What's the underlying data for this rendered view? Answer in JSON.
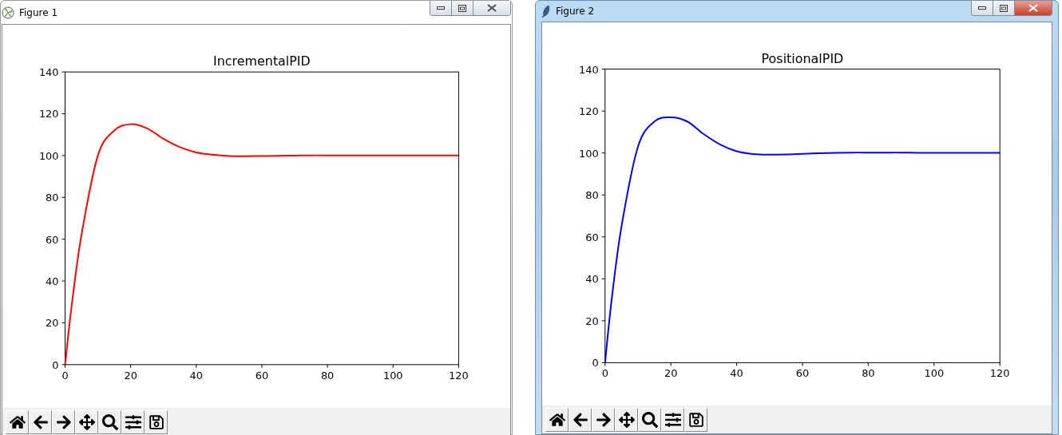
{
  "windows": [
    {
      "title": "Figure 1",
      "active": false,
      "chart_data": {
        "type": "line",
        "title": "IncrementalPID",
        "x": [
          0,
          2,
          5,
          10,
          15,
          20,
          25,
          30,
          35,
          40,
          45,
          50,
          55,
          60,
          65,
          70,
          75,
          80,
          85,
          90,
          95,
          100,
          105,
          110,
          115,
          120
        ],
        "series": [
          {
            "color": "#ff0000",
            "values": [
              0,
              28,
              62,
              100,
              112,
              115,
              113,
              108,
              104,
              101.5,
              100.4,
              99.8,
              99.7,
              99.8,
              99.9,
              100,
              100.1,
              100.1,
              100.1,
              100.1,
              100.1,
              100.1,
              100.1,
              100.1,
              100.1,
              100.1
            ]
          }
        ],
        "xlim": [
          0,
          120
        ],
        "ylim": [
          0,
          140
        ],
        "xticks": [
          0,
          20,
          40,
          60,
          80,
          100,
          120
        ],
        "yticks": [
          0,
          20,
          40,
          60,
          80,
          100,
          120,
          140
        ]
      },
      "toolbar": [
        {
          "kind": "home"
        },
        {
          "kind": "back"
        },
        {
          "kind": "forward"
        },
        {
          "kind": "pan"
        },
        {
          "kind": "zoom"
        },
        {
          "kind": "configure"
        },
        {
          "kind": "save"
        }
      ]
    },
    {
      "title": "Figure 2",
      "active": true,
      "chart_data": {
        "type": "line",
        "title": "PositionalPID",
        "x": [
          0,
          2,
          5,
          10,
          15,
          20,
          25,
          30,
          35,
          40,
          45,
          50,
          55,
          60,
          65,
          70,
          75,
          80,
          85,
          90,
          95,
          100,
          105,
          110,
          115,
          120
        ],
        "series": [
          {
            "color": "#0000ff",
            "values": [
              0,
              30,
              65,
              103,
              115,
              117,
              115,
              109,
              104,
              100.8,
              99.5,
              99.2,
              99.3,
              99.6,
              99.9,
              100.1,
              100.2,
              100.2,
              100.2,
              100.2,
              100.1,
              100.1,
              100.1,
              100.1,
              100.1,
              100.1
            ]
          }
        ],
        "xlim": [
          0,
          120
        ],
        "ylim": [
          0,
          140
        ],
        "xticks": [
          0,
          20,
          40,
          60,
          80,
          100,
          120
        ],
        "yticks": [
          0,
          20,
          40,
          60,
          80,
          100,
          120,
          140
        ]
      },
      "toolbar": [
        {
          "kind": "home"
        },
        {
          "kind": "back"
        },
        {
          "kind": "forward"
        },
        {
          "kind": "pan"
        },
        {
          "kind": "zoom"
        },
        {
          "kind": "configure"
        },
        {
          "kind": "save"
        }
      ]
    }
  ]
}
